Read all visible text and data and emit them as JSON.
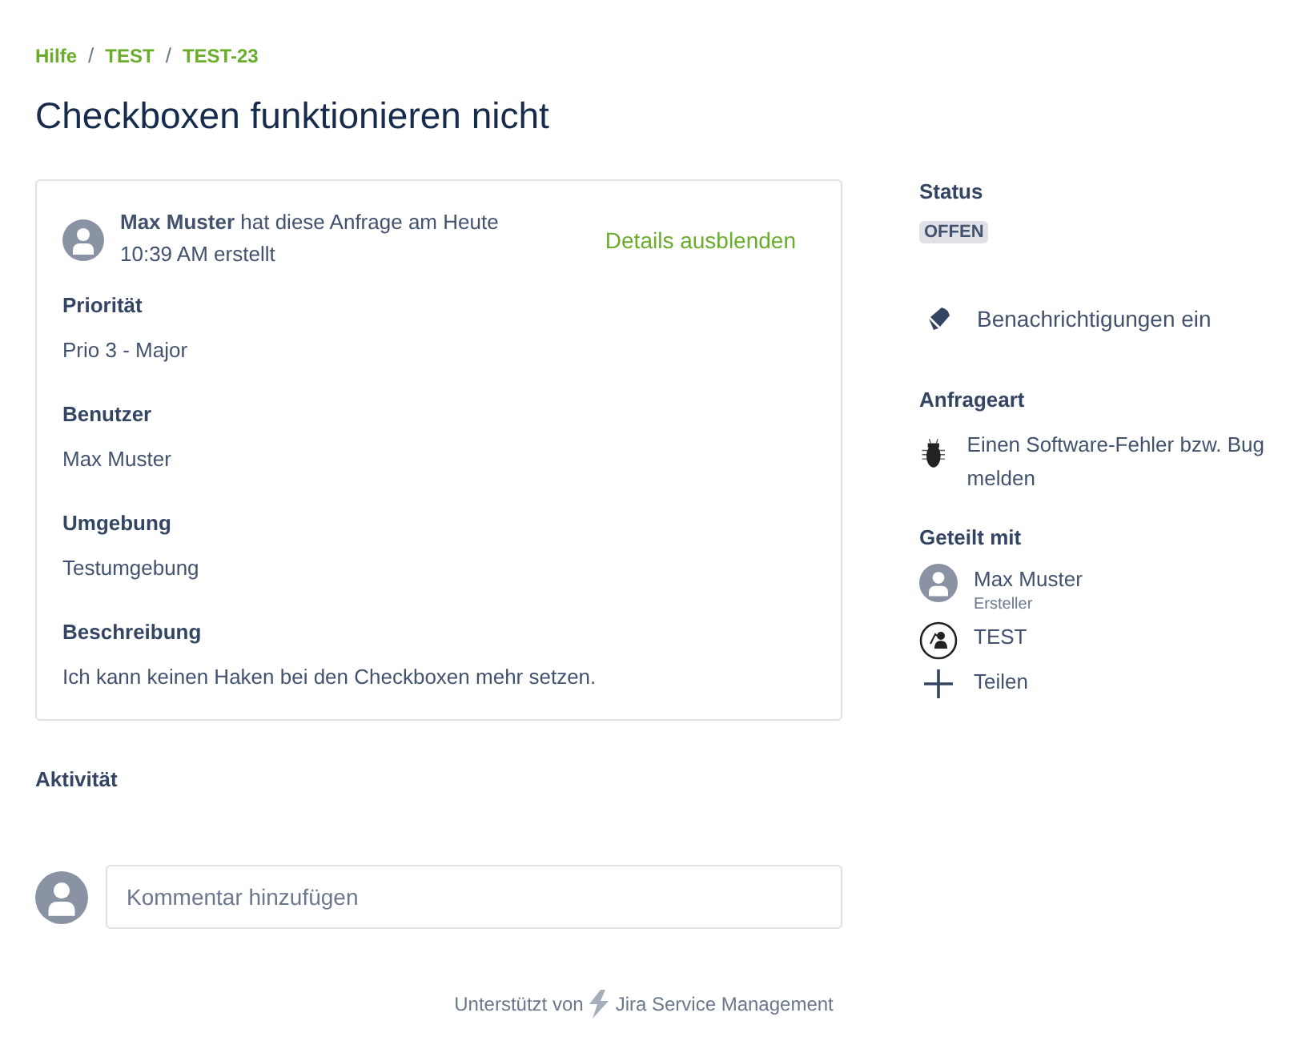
{
  "breadcrumbs": {
    "separator": "/",
    "items": [
      {
        "label": "Hilfe"
      },
      {
        "label": "TEST"
      },
      {
        "label": "TEST-23"
      }
    ]
  },
  "title": "Checkboxen funktionieren nicht",
  "request": {
    "summary": "**Max Muster** hat diese Anfrage am Heute 10:39 AM erstellt",
    "toggle": "Details ausblenden",
    "fields": [
      {
        "label": "Priorität",
        "value": "Prio 3 - Major"
      },
      {
        "label": "Benutzer",
        "value": "Max Muster"
      },
      {
        "label": "Umgebung",
        "value": "Testumgebung"
      },
      {
        "label": "Beschreibung",
        "value": "Ich kann keinen Haken bei den Checkboxen mehr setzen."
      }
    ]
  },
  "activity": {
    "heading": "Aktivität",
    "comment_placeholder": "Kommentar hinzufügen"
  },
  "sidebar": {
    "status": {
      "label": "Status",
      "value": "OFFEN"
    },
    "notifications": "Benachrichtigungen ein",
    "request_type": {
      "label": "Anfrageart",
      "value": "Einen Software-Fehler bzw. Bug melden"
    },
    "shared": {
      "label": "Geteilt mit",
      "items": [
        {
          "kind": "user",
          "name": "Max Muster",
          "role": "Ersteller"
        },
        {
          "kind": "group",
          "name": "TEST"
        },
        {
          "kind": "add",
          "name": "Teilen"
        }
      ]
    }
  },
  "footer": {
    "prefix": "Unterstützt von",
    "product": "Jira Service Management"
  }
}
